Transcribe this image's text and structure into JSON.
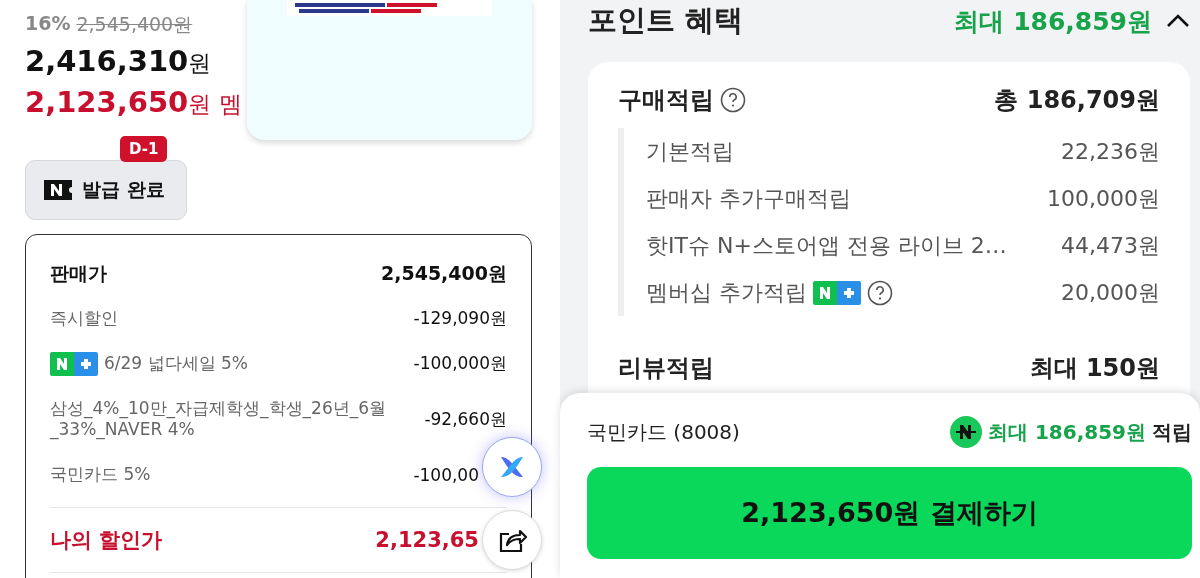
{
  "product": {
    "discount_rate": "16%",
    "original_price": "2,545,400원",
    "price": "2,416,310",
    "price_unit": "원",
    "member_price": "2,123,650",
    "member_price_unit": "원",
    "member_label": "멤"
  },
  "coupon": {
    "badge": "D-1",
    "label": "발급 완료"
  },
  "price_breakdown": {
    "rows": [
      {
        "kind": "header",
        "label": "판매가",
        "value": "2,545,400원"
      },
      {
        "kind": "discount",
        "label": "즉시할인",
        "value": "-129,090원"
      },
      {
        "kind": "membership",
        "label": "6/29 넓다세일 5%",
        "value": "-100,000원"
      },
      {
        "kind": "discount",
        "label": "삼성_4%_10만_자급제학생_학생_26년_6월_33%_NAVER 4%",
        "value": "-92,660원"
      },
      {
        "kind": "discount",
        "label": "국민카드 5%",
        "value": "-100,00"
      },
      {
        "kind": "total",
        "label": "나의 할인가",
        "value": "2,123,65"
      }
    ]
  },
  "point_benefits": {
    "title": "포인트 혜택",
    "max": "최대 186,859원",
    "expanded": true,
    "purchase": {
      "title": "구매적립",
      "total": "총 186,709원",
      "items": [
        {
          "label": "기본적립",
          "value": "22,236원",
          "membership": false,
          "help": false
        },
        {
          "label": "판매자 추가구매적립",
          "value": "100,000원",
          "membership": false,
          "help": false
        },
        {
          "label": "핫IT슈 N+스토어앱 전용 라이브 2…",
          "value": "44,473원",
          "membership": false,
          "help": false
        },
        {
          "label": "멤버십 추가적립",
          "value": "20,000원",
          "membership": true,
          "help": true
        }
      ]
    },
    "review": {
      "title": "리뷰적립",
      "value": "최대 150원"
    }
  },
  "checkout": {
    "card": "국민카드 (8008)",
    "points": "최대 186,859원",
    "points_suffix": "적립",
    "button": "2,123,650원 결제하기"
  }
}
